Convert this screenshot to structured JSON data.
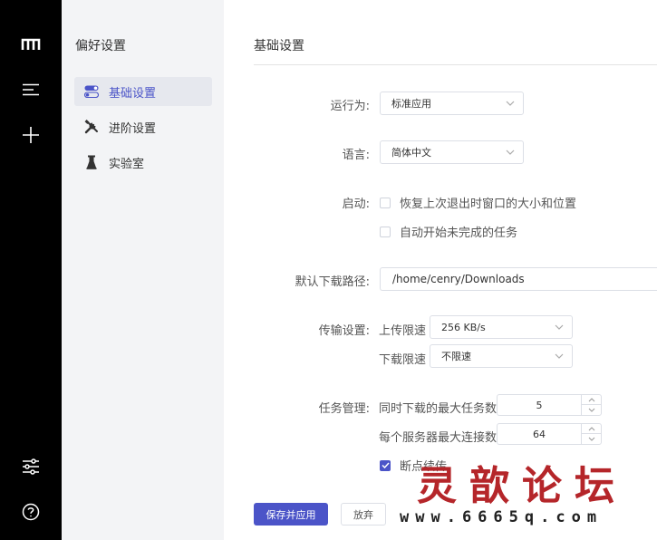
{
  "rail": {
    "icons": [
      "app-logo-icon",
      "menu-icon",
      "add-icon",
      "settings-sliders-icon",
      "help-icon"
    ]
  },
  "subnav": {
    "title": "偏好设置",
    "items": [
      {
        "label": "基础设置",
        "icon": "toggle-icon",
        "active": true
      },
      {
        "label": "进阶设置",
        "icon": "tools-icon",
        "active": false
      },
      {
        "label": "实验室",
        "icon": "flask-icon",
        "active": false
      }
    ]
  },
  "main": {
    "title": "基础设置",
    "run_as": {
      "label": "运行为:",
      "value": "标准应用"
    },
    "language": {
      "label": "语言:",
      "value": "简体中文"
    },
    "startup": {
      "label": "启动:",
      "options": [
        {
          "label": "恢复上次退出时窗口的大小和位置",
          "checked": false
        },
        {
          "label": "自动开始未完成的任务",
          "checked": false
        }
      ]
    },
    "download_path": {
      "label": "默认下载路径:",
      "value": "/home/cenry/Downloads"
    },
    "transfer": {
      "label": "传输设置:",
      "upload": {
        "label": "上传限速",
        "value": "256 KB/s"
      },
      "download": {
        "label": "下载限速",
        "value": "不限速"
      }
    },
    "tasks": {
      "label": "任务管理:",
      "max_tasks": {
        "label": "同时下载的最大任务数",
        "value": "5"
      },
      "max_conn": {
        "label": "每个服务器最大连接数",
        "value": "64"
      },
      "resume": {
        "label": "断点续传",
        "checked": true
      }
    },
    "buttons": {
      "save": "保存并应用",
      "discard": "放弃"
    }
  },
  "watermark": {
    "text": "灵歆论坛",
    "url": "www.6665q.com"
  },
  "colors": {
    "accent": "#4b54c8",
    "rail": "#000000",
    "subnav": "#f3f4f6",
    "watermark": "#b5262a"
  }
}
